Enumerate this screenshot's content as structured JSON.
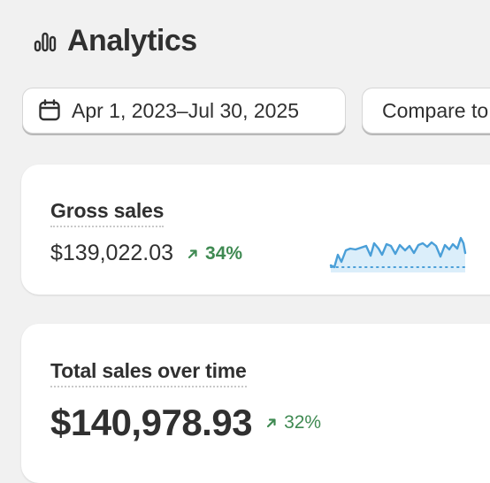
{
  "header": {
    "title": "Analytics",
    "icon": "bar-chart-icon"
  },
  "toolbar": {
    "date_range_label": "Apr 1, 2023–Jul 30, 2025",
    "date_icon": "calendar-icon",
    "compare_label": "Compare to"
  },
  "gross_sales": {
    "title": "Gross sales",
    "value": "$139,022.03",
    "change": "34%",
    "change_direction": "up",
    "change_color": "#3f8a52",
    "sparkline_color": "#4a9fd8",
    "sparkline_fill": "#dbeefa"
  },
  "total_sales": {
    "title": "Total sales over time",
    "value": "$140,978.93",
    "change": "32%",
    "change_direction": "up",
    "change_color": "#3f8a52"
  }
}
